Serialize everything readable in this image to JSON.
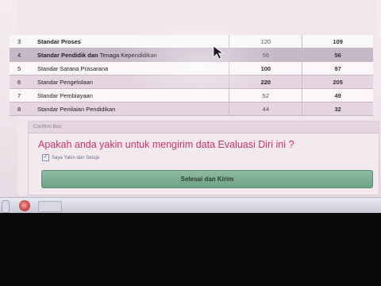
{
  "evaluation_table": {
    "rows": [
      {
        "no": "3",
        "name": "Standar Proses",
        "value_1": "120",
        "value_2": "109"
      },
      {
        "no": "4",
        "name": "Standar Pendidik dan Tenaga Kependidikan",
        "value_1": "56",
        "value_2": "56"
      },
      {
        "no": "5",
        "name": "Standar Sarana Prasarana",
        "value_1": "100",
        "value_2": "97"
      },
      {
        "no": "6",
        "name": "Standar Pengelolaan",
        "value_1": "220",
        "value_2": "205"
      },
      {
        "no": "7",
        "name": "Standar Pembiayaan",
        "value_1": "52",
        "value_2": "49"
      },
      {
        "no": "8",
        "name": "Standar Penilaian Pendidikan",
        "value_1": "44",
        "value_2": "32"
      }
    ]
  },
  "confirm_box": {
    "header": "Confirm Box",
    "question": "Apakah anda yakin untuk mengirim data Evaluasi Diri ini ?",
    "agree_label": "Saya Yakin dan Setuju",
    "agree_checked": true,
    "submit_label": "Selesai dan Kirim"
  },
  "colors": {
    "question_text": "#d2335a",
    "submit_button": "#7fae95"
  },
  "icons": {
    "cursor": "arrow-cursor-icon",
    "taskbar_browser": "browser-icon"
  }
}
